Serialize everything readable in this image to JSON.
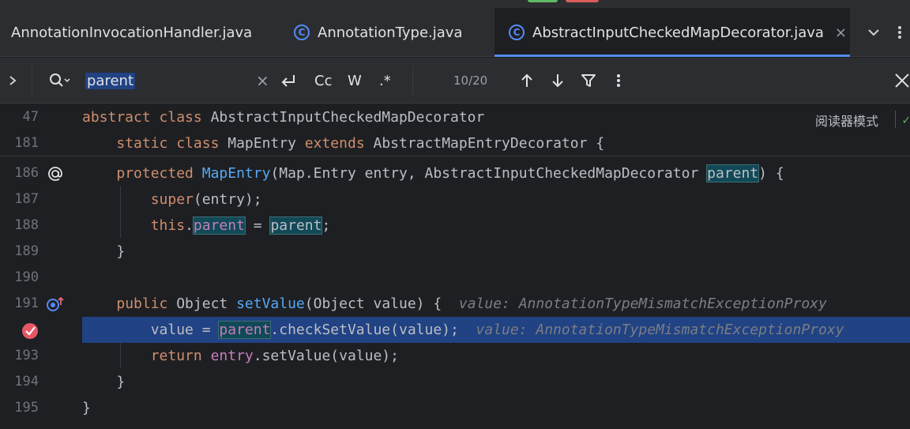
{
  "tabs": [
    {
      "label": "AnnotationInvocationHandler.java",
      "icon": "class-icon"
    },
    {
      "label": "AnnotationType.java",
      "icon": "class-icon"
    },
    {
      "label": "AbstractInputCheckedMapDecorator.java",
      "icon": "class-icon",
      "active": true,
      "close": "×"
    }
  ],
  "search": {
    "query": "parent",
    "clear": "×",
    "match_case": "Cc",
    "words": "W",
    "regex": ".*",
    "counter": "10/20"
  },
  "editor": {
    "reader_mode": "阅读器模式",
    "sticky": [
      {
        "num": "47",
        "code": "abstract class AbstractInputCheckedMapDecorator"
      },
      {
        "num": "181",
        "code": "    static class MapEntry extends AbstractMapEntryDecorator {"
      }
    ],
    "lines": [
      {
        "num": "186",
        "code": "    protected MapEntry(Map.Entry entry, AbstractInputCheckedMapDecorator parent) {"
      },
      {
        "num": "187",
        "code": "        super(entry);"
      },
      {
        "num": "188",
        "code": "        this.parent = parent;"
      },
      {
        "num": "189",
        "code": "    }"
      },
      {
        "num": "190",
        "code": ""
      },
      {
        "num": "191",
        "code": "    public Object setValue(Object value) {",
        "hint": "value: AnnotationTypeMismatchExceptionProxy"
      },
      {
        "num": "",
        "code": "        value = parent.checkSetValue(value);",
        "hint": "value: AnnotationTypeMismatchExceptionProxy"
      },
      {
        "num": "193",
        "code": "        return entry.setValue(value);"
      },
      {
        "num": "194",
        "code": "    }"
      },
      {
        "num": "195",
        "code": "}"
      }
    ]
  },
  "colors": {
    "keyword": "#cf8e6d",
    "function": "#56a8f5",
    "field": "#c77dbb",
    "execution_line": "#214283",
    "search_highlight": "#114957"
  }
}
